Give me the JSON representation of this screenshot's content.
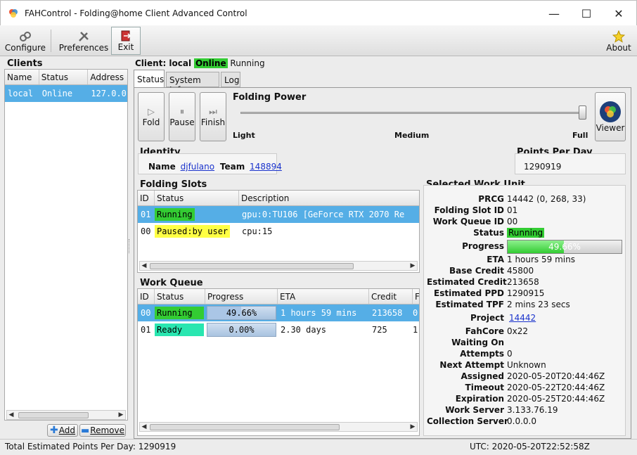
{
  "window": {
    "title": "FAHControl - Folding@home Client Advanced Control",
    "minimize": "—",
    "maximize": "☐",
    "close": "✕"
  },
  "toolbar": {
    "configure": "Configure",
    "preferences": "Preferences",
    "exit": "Exit",
    "about": "About"
  },
  "clients": {
    "title": "Clients",
    "columns": [
      "Name",
      "Status",
      "Address"
    ],
    "rows": [
      {
        "name": "local",
        "status": "Online",
        "address": "127.0.0."
      }
    ],
    "add": "Add",
    "remove": "Remove"
  },
  "client_header": {
    "label": "Client: local",
    "status": "Online",
    "state": "Running"
  },
  "tabs": [
    "Status",
    "System Info",
    "Log"
  ],
  "controls": {
    "fold": "Fold",
    "pause": "Pause",
    "finish": "Finish",
    "viewer": "Viewer"
  },
  "folding_power": {
    "title": "Folding Power",
    "light": "Light",
    "medium": "Medium",
    "full": "Full",
    "level": 1.0
  },
  "identity": {
    "title": "Identity",
    "name_label": "Name",
    "name": "djfulano",
    "team_label": "Team",
    "team": "148894"
  },
  "ppd": {
    "title": "Points Per Day",
    "value": "1290919"
  },
  "slots": {
    "title": "Folding Slots",
    "columns": [
      "ID",
      "Status",
      "Description"
    ],
    "rows": [
      {
        "id": "01",
        "status": "Running",
        "desc": "gpu:0:TU106 [GeForce RTX 2070 Re"
      },
      {
        "id": "00",
        "status": "Paused:by user",
        "desc": "cpu:15"
      }
    ]
  },
  "queue": {
    "title": "Work Queue",
    "columns": [
      "ID",
      "Status",
      "Progress",
      "ETA",
      "Credit",
      "F"
    ],
    "rows": [
      {
        "id": "00",
        "status": "Running",
        "progress": "49.66%",
        "progress_value": 0.4966,
        "eta": "1 hours 59 mins",
        "credit": "213658",
        "extra": "0"
      },
      {
        "id": "01",
        "status": "Ready",
        "progress": "0.00%",
        "progress_value": 0.0,
        "eta": "2.30 days",
        "credit": "725",
        "extra": "1"
      }
    ]
  },
  "wu": {
    "title": "Selected Work Unit",
    "fields": [
      {
        "label": "PRCG",
        "value": "14442 (0, 268, 33)"
      },
      {
        "label": "Folding Slot ID",
        "value": "01"
      },
      {
        "label": "Work Queue ID",
        "value": "00"
      },
      {
        "label": "Status",
        "value": "Running"
      },
      {
        "label": "Progress",
        "value": "49.66%"
      },
      {
        "label": "ETA",
        "value": "1 hours 59 mins"
      },
      {
        "label": "Base Credit",
        "value": "45800"
      },
      {
        "label": "Estimated Credit",
        "value": "213658"
      },
      {
        "label": "Estimated PPD",
        "value": "1290915"
      },
      {
        "label": "Estimated TPF",
        "value": "2 mins 23 secs"
      },
      {
        "label": "Project",
        "value": "14442"
      },
      {
        "label": "FahCore",
        "value": "0x22"
      },
      {
        "label": "Waiting On",
        "value": ""
      },
      {
        "label": "Attempts",
        "value": "0"
      },
      {
        "label": "Next Attempt",
        "value": "Unknown"
      },
      {
        "label": "Assigned",
        "value": "2020-05-20T20:44:46Z"
      },
      {
        "label": "Timeout",
        "value": "2020-05-22T20:44:46Z"
      },
      {
        "label": "Expiration",
        "value": "2020-05-25T20:44:46Z"
      },
      {
        "label": "Work Server",
        "value": "3.133.76.19"
      },
      {
        "label": "Collection Server",
        "value": "0.0.0.0"
      }
    ],
    "progress_value": 0.4966
  },
  "statusbar": {
    "total": "Total Estimated Points Per Day: 1290919",
    "utc": "UTC: 2020-05-20T22:52:58Z"
  },
  "colors": {
    "running": "#33cc33",
    "paused": "#ffff44",
    "ready": "#29e6b0",
    "selection": "#55aee6",
    "link": "#1a33cc"
  }
}
